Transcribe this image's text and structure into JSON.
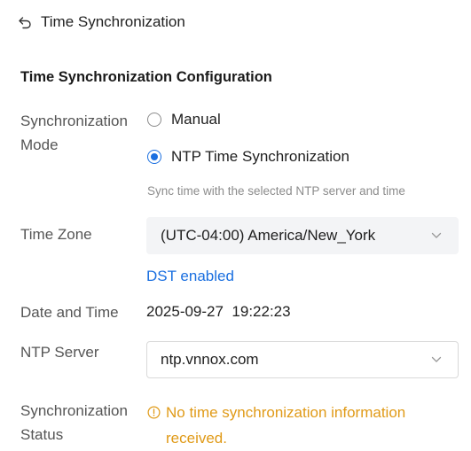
{
  "header": {
    "title": "Time Synchronization"
  },
  "section": {
    "title": "Time Synchronization Configuration"
  },
  "sync_mode": {
    "label": "Synchronization Mode",
    "options": [
      {
        "label": "Manual",
        "checked": false
      },
      {
        "label": "NTP Time Synchronization",
        "checked": true
      }
    ],
    "hint": "Sync time with the selected NTP server and time"
  },
  "time_zone": {
    "label": "Time Zone",
    "value": "(UTC-04:00) America/New_York",
    "dst_link": "DST enabled"
  },
  "date_time": {
    "label": "Date and Time",
    "value": "2025-09-27  19:22:23"
  },
  "ntp_server": {
    "label": "NTP Server",
    "value": "ntp.vnnox.com"
  },
  "sync_status": {
    "label": "Synchronization Status",
    "message": "No time synchronization information received."
  },
  "colors": {
    "accent": "#1a6fe0",
    "warning": "#e09a17",
    "label": "#555555",
    "hint": "#8c8c8c"
  },
  "icons": {
    "back": "back-arrow-icon",
    "chevron": "chevron-down-icon",
    "warning": "info-circle-icon"
  }
}
